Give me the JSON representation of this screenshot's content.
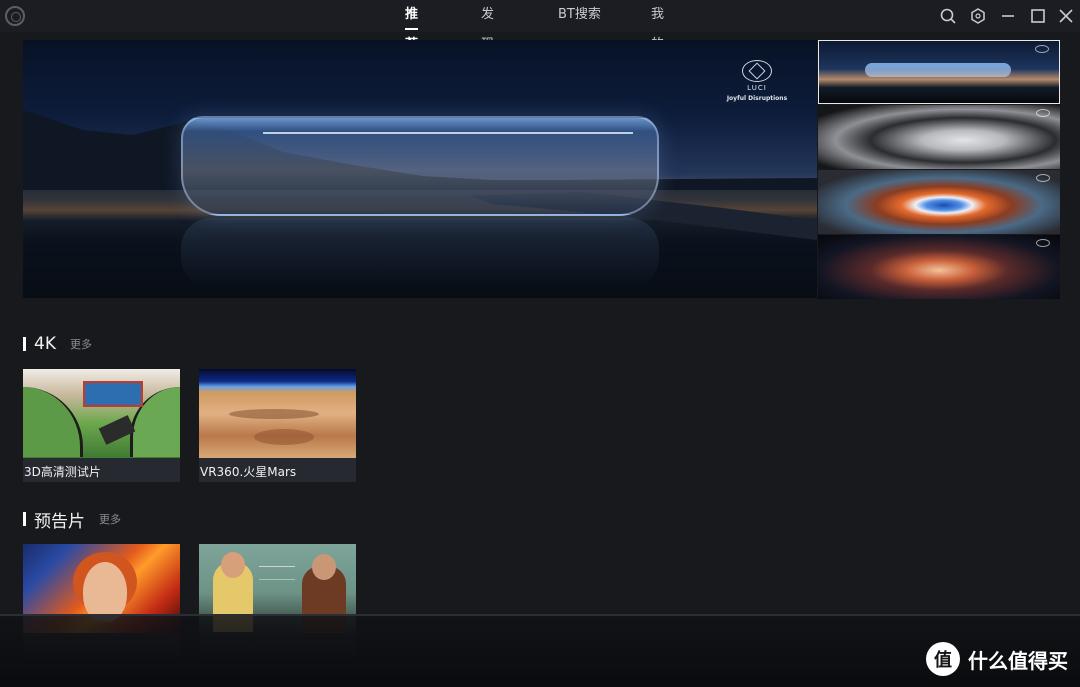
{
  "topbar": {
    "tabs": [
      {
        "label": "推荐",
        "active": true
      },
      {
        "label": "发现",
        "active": false
      },
      {
        "label": "BT搜索",
        "active": false
      },
      {
        "label": "我的",
        "active": false
      }
    ],
    "icons": [
      "search-icon",
      "settings-hex-icon",
      "minimize-icon",
      "maximize-icon",
      "close-icon"
    ]
  },
  "banner": {
    "brand_name": "LUCI",
    "brand_tagline": "Joyful Disruptions",
    "thumbnails": [
      "banner-thumb-1",
      "banner-thumb-2",
      "banner-thumb-3",
      "banner-thumb-4"
    ]
  },
  "sections": [
    {
      "title": "4K",
      "more": "更多",
      "items": [
        {
          "caption": "3D高清测试片"
        },
        {
          "caption": "VR360.火星Mars"
        }
      ]
    },
    {
      "title": "预告片",
      "more": "更多",
      "items": [
        {
          "caption": ""
        },
        {
          "caption": ""
        }
      ]
    }
  ],
  "watermark": {
    "glyph": "值",
    "text": "什么值得买"
  },
  "colors": {
    "background": "#17191d",
    "topbar": "#1b1d22",
    "card": "#262930",
    "muted": "#8a8d93"
  }
}
